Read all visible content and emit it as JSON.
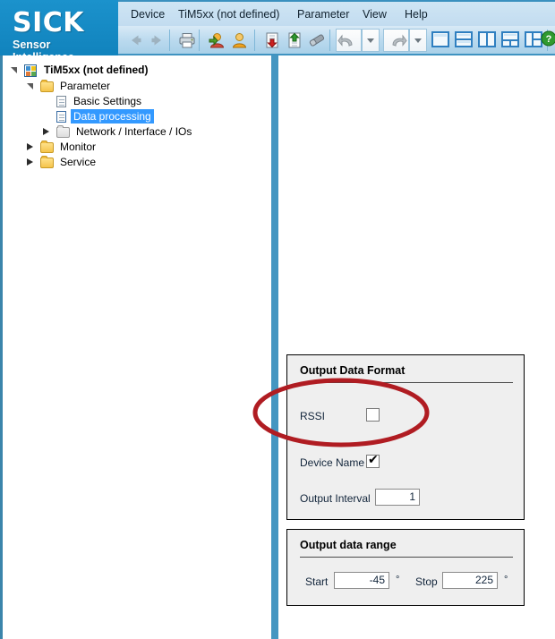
{
  "app": {
    "brand_name": "SICK",
    "brand_tagline": "Sensor Intelligence.",
    "brand_color": "#1589c5"
  },
  "menubar": {
    "items": [
      {
        "label": "Device"
      },
      {
        "label": "TiM5xx (not defined)"
      },
      {
        "label": "Parameter"
      },
      {
        "label": "View"
      },
      {
        "label": "Help"
      }
    ]
  },
  "toolbar": {
    "items": [
      {
        "name": "back-icon",
        "tooltip": "Back"
      },
      {
        "name": "forward-icon",
        "tooltip": "Forward"
      },
      {
        "name": "print-icon",
        "tooltip": "Print"
      },
      {
        "name": "user-login-icon",
        "tooltip": "Login"
      },
      {
        "name": "user-logout-icon",
        "tooltip": "Logout"
      },
      {
        "name": "download-to-device-icon",
        "tooltip": "Download"
      },
      {
        "name": "upload-from-device-icon",
        "tooltip": "Upload"
      },
      {
        "name": "eraser-icon",
        "tooltip": "Clear"
      },
      {
        "name": "undo-icon",
        "tooltip": "Undo"
      },
      {
        "name": "undo-dropdown-icon",
        "tooltip": "Undo history"
      },
      {
        "name": "redo-icon",
        "tooltip": "Redo"
      },
      {
        "name": "redo-dropdown-icon",
        "tooltip": "Redo history"
      },
      {
        "name": "layout-single-icon",
        "tooltip": "Single view"
      },
      {
        "name": "layout-horizontal-split-icon",
        "tooltip": "Horizontal split"
      },
      {
        "name": "layout-vertical-split-icon",
        "tooltip": "Vertical split"
      },
      {
        "name": "layout-three-bottom-icon",
        "tooltip": "Three panes"
      },
      {
        "name": "layout-three-right-icon",
        "tooltip": "Three panes right"
      },
      {
        "name": "help-icon",
        "tooltip": "Help"
      }
    ]
  },
  "tree": {
    "nodes": [
      {
        "label": "TiM5xx (not defined)",
        "depth": 0,
        "icon": "device-icon",
        "expander": "open",
        "selected": false,
        "bold": true
      },
      {
        "label": "Parameter",
        "depth": 1,
        "icon": "folder-icon",
        "expander": "open",
        "selected": false,
        "bold": false
      },
      {
        "label": "Basic Settings",
        "depth": 2,
        "icon": "page-icon",
        "expander": "none",
        "selected": false,
        "bold": false
      },
      {
        "label": "Data processing",
        "depth": 2,
        "icon": "page-icon",
        "expander": "none",
        "selected": true,
        "bold": false
      },
      {
        "label": "Network / Interface / IOs",
        "depth": 2,
        "icon": "folder-grey-icon",
        "expander": "closed",
        "selected": false,
        "bold": false
      },
      {
        "label": "Monitor",
        "depth": 1,
        "icon": "folder-icon",
        "expander": "closed",
        "selected": false,
        "bold": false
      },
      {
        "label": "Service",
        "depth": 1,
        "icon": "folder-icon",
        "expander": "closed",
        "selected": false,
        "bold": false
      }
    ],
    "selection_color": "#3399ff"
  },
  "panels": {
    "output_data_format": {
      "title": "Output Data Format",
      "rssi_label": "RSSI",
      "rssi_checked": false,
      "device_name_label": "Device Name",
      "device_name_checked": true,
      "output_interval_label": "Output Interval",
      "output_interval_value": "1"
    },
    "output_data_range": {
      "title": "Output data range",
      "start_label": "Start",
      "start_value": "-45",
      "start_unit": "°",
      "stop_label": "Stop",
      "stop_value": "225",
      "stop_unit": "°"
    }
  },
  "annotation": {
    "name": "red-highlight-ellipse",
    "target": "RSSI",
    "color": "#b01c22"
  }
}
